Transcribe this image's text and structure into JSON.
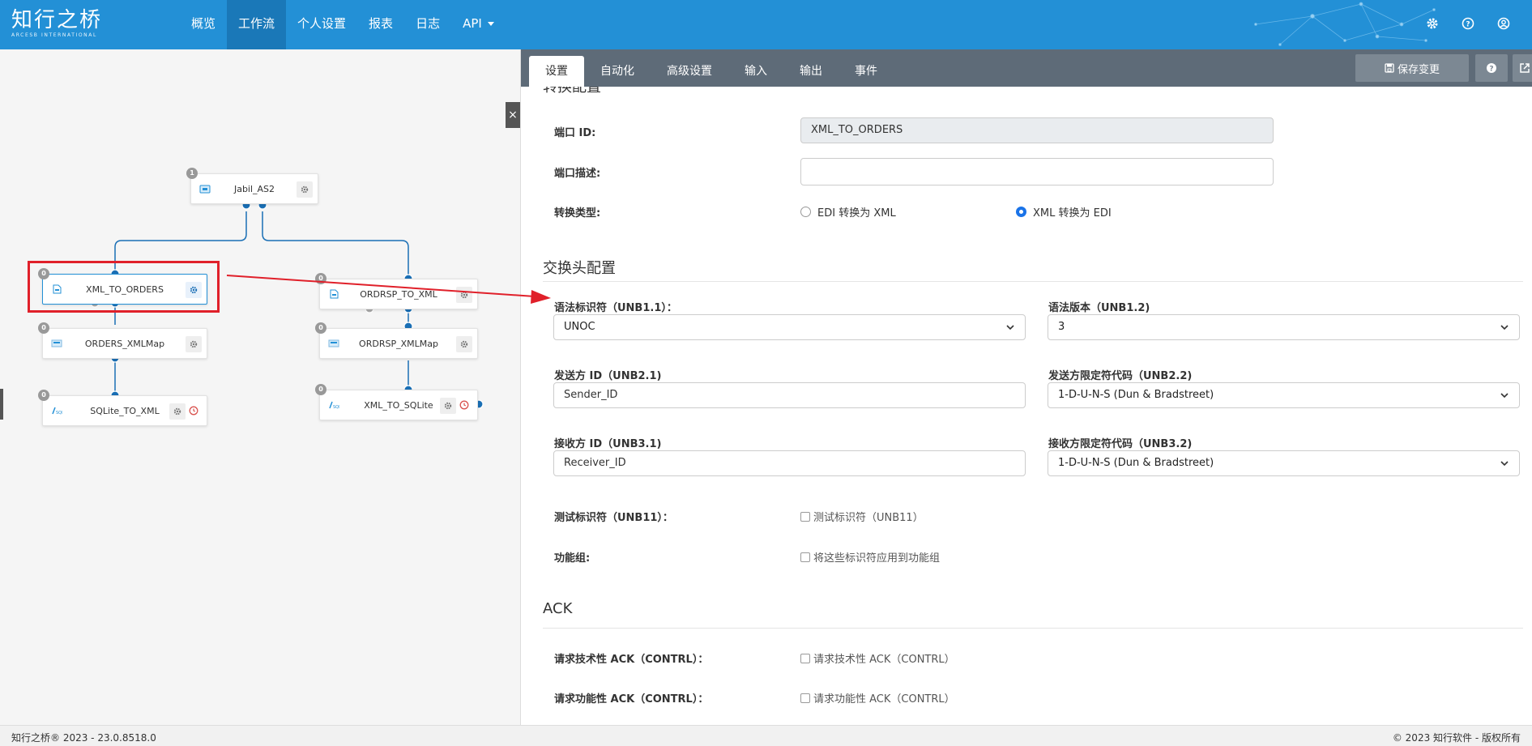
{
  "app": {
    "logo_main": "知行之桥",
    "logo_sub": "ARCESB INTERNATIONAL"
  },
  "nav": {
    "items": [
      {
        "label": "概览"
      },
      {
        "label": "工作流"
      },
      {
        "label": "个人设置"
      },
      {
        "label": "报表"
      },
      {
        "label": "日志"
      },
      {
        "label": "API"
      }
    ],
    "active_index": 1
  },
  "top_icons": [
    "gear-icon",
    "help-icon",
    "user-icon"
  ],
  "workflow": {
    "nodes": [
      {
        "id": "jabil",
        "label": "Jabil_AS2",
        "badge": "1",
        "icon": "as2-icon"
      },
      {
        "id": "xml_to_orders",
        "label": "XML_TO_ORDERS",
        "badge": "0",
        "icon": "file-icon",
        "selected": true
      },
      {
        "id": "ordrsp_to_xml",
        "label": "ORDRSP_TO_XML",
        "badge": "0",
        "icon": "file-icon"
      },
      {
        "id": "orders_xmlmap",
        "label": "ORDERS_XMLMap",
        "badge": "0",
        "icon": "map-icon"
      },
      {
        "id": "ordrsp_xmlmap",
        "label": "ORDRSP_XMLMap",
        "badge": "0",
        "icon": "map-icon"
      },
      {
        "id": "sqlite_to_xml",
        "label": "SQLite_TO_XML",
        "badge": "0",
        "icon": "sqlite-icon"
      },
      {
        "id": "xml_to_sqlite",
        "label": "XML_TO_SQLite",
        "badge": "0",
        "icon": "sqlite-icon"
      }
    ]
  },
  "panel": {
    "tabs": [
      {
        "label": "设置"
      },
      {
        "label": "自动化"
      },
      {
        "label": "高级设置"
      },
      {
        "label": "输入"
      },
      {
        "label": "输出"
      },
      {
        "label": "事件"
      }
    ],
    "active_tab": 0,
    "save_label": "保存变更",
    "partial_section_title": "转换配置",
    "port_id_label": "端口 ID:",
    "port_id_value": "XML_TO_ORDERS",
    "port_desc_label": "端口描述:",
    "port_desc_value": "",
    "convert_type_label": "转换类型:",
    "convert_options": [
      {
        "label": "EDI 转换为 XML",
        "selected": false
      },
      {
        "label": "XML 转换为 EDI",
        "selected": true
      }
    ],
    "interchange_title": "交换头配置",
    "syntax_id_label": "语法标识符（UNB1.1）：",
    "syntax_id_value": "UNOC",
    "syntax_ver_label": "语法版本（UNB1.2)",
    "syntax_ver_value": "3",
    "sender_id_label": "发送方 ID（UNB2.1)",
    "sender_id_value": "Sender_ID",
    "sender_qual_label": "发送方限定符代码（UNB2.2)",
    "sender_qual_value": "1-D-U-N-S (Dun & Bradstreet)",
    "receiver_id_label": "接收方 ID（UNB3.1)",
    "receiver_id_value": "Receiver_ID",
    "receiver_qual_label": "接收方限定符代码（UNB3.2)",
    "receiver_qual_value": "1-D-U-N-S (Dun & Bradstreet)",
    "test_label": "测试标识符（UNB11）：",
    "test_check_label": "测试标识符（UNB11）",
    "func_group_label": "功能组:",
    "func_group_check_label": "将这些标识符应用到功能组",
    "ack_title": "ACK",
    "tech_ack_label": "请求技术性 ACK（CONTRL）：",
    "tech_ack_check_label": "请求技术性 ACK（CONTRL）",
    "func_ack_label": "请求功能性 ACK（CONTRL）：",
    "func_ack_check_label": "请求功能性 ACK（CONTRL）"
  },
  "footer": {
    "left": "知行之桥® 2023 - 23.0.8518.0",
    "right": "© 2023 知行软件 - 版权所有"
  },
  "colors": {
    "topbar": "#2390d6",
    "tabbar": "#5e6b78",
    "link_line": "#1a6fb5",
    "highlight": "#e0202a"
  }
}
